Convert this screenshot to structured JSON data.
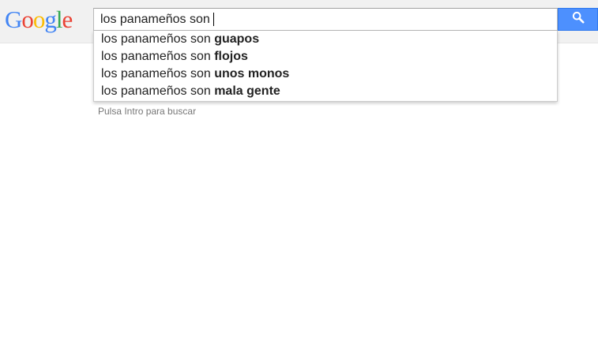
{
  "logo": {
    "letters": [
      "G",
      "o",
      "o",
      "g",
      "l",
      "e"
    ],
    "colors": [
      "#4285f4",
      "#ea4335",
      "#fbbc05",
      "#4285f4",
      "#34a853",
      "#ea4335"
    ]
  },
  "search": {
    "query": "los panameños son "
  },
  "search_button": {
    "icon": "search-icon",
    "color": "#4d90fe"
  },
  "suggestions": [
    {
      "prefix": "los panameños son ",
      "completion": "guapos"
    },
    {
      "prefix": "los panameños son ",
      "completion": "flojos"
    },
    {
      "prefix": "los panameños son ",
      "completion": "unos monos"
    },
    {
      "prefix": "los panameños son ",
      "completion": "mala gente"
    }
  ],
  "hint": "Pulsa Intro para buscar"
}
